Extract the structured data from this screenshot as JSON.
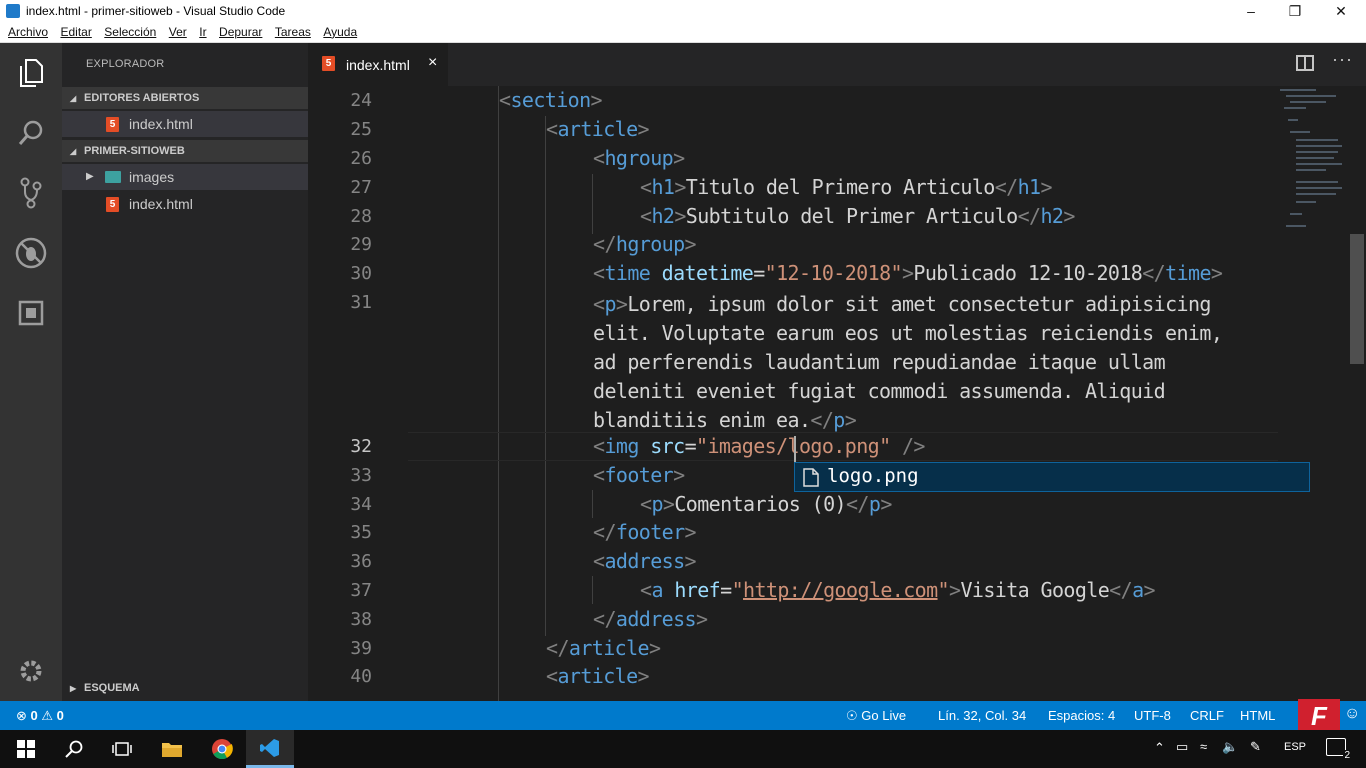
{
  "window": {
    "title": "index.html - primer-sitioweb - Visual Studio Code"
  },
  "menu": [
    "Archivo",
    "Editar",
    "Selección",
    "Ver",
    "Ir",
    "Depurar",
    "Tareas",
    "Ayuda"
  ],
  "sidebar": {
    "header": "EXPLORADOR",
    "open_editors_label": "EDITORES ABIERTOS",
    "open_editors": [
      {
        "name": "index.html"
      }
    ],
    "folder_label": "PRIMER-SITIOWEB",
    "folder_items": [
      {
        "name": "images"
      },
      {
        "name": "index.html"
      }
    ],
    "outline_label": "ESQUEMA"
  },
  "tab": {
    "label": "index.html",
    "close": "×"
  },
  "editor": {
    "current_line": "32",
    "lines": [
      {
        "n": "24",
        "t": "<section>"
      },
      {
        "n": "25",
        "t": "<article>"
      },
      {
        "n": "26",
        "t": "<hgroup>"
      },
      {
        "n": "27",
        "t": "<h1>Titulo del Primero Articulo</h1>"
      },
      {
        "n": "28",
        "t": "<h2>Subtitulo del Primer Articulo</h2>"
      },
      {
        "n": "29",
        "t": "</hgroup>"
      },
      {
        "n": "30",
        "t": "<time datetime=\"12-10-2018\">Publicado 12-10-2018</time>"
      },
      {
        "n": "31",
        "t": "<p>Lorem, ipsum dolor sit amet consectetur adipisicing elit. Voluptate earum eos ut molestias reiciendis enim, ad perferendis laudantium repudiandae itaque ullam deleniti eveniet fugiat commodi assumenda. Aliquid blanditiis enim ea.</p>"
      },
      {
        "n": "32",
        "t": "<img src=\"images/logo.png\" />"
      },
      {
        "n": "33",
        "t": "<footer>"
      },
      {
        "n": "34",
        "t": "<p>Comentarios (0)</p>"
      },
      {
        "n": "35",
        "t": "</footer>"
      },
      {
        "n": "36",
        "t": "<address>"
      },
      {
        "n": "37",
        "t": "<a href=\"http://google.com\">Visita Google</a>"
      },
      {
        "n": "38",
        "t": "</address>"
      },
      {
        "n": "39",
        "t": "</article>"
      },
      {
        "n": "40",
        "t": "<article>"
      }
    ],
    "suggestion": "logo.png"
  },
  "status": {
    "errors": "0",
    "warnings": "0",
    "golive": "Go Live",
    "position": "Lín. 32, Col. 34",
    "spaces": "Espacios: 4",
    "encoding": "UTF-8",
    "eol": "CRLF",
    "language": "HTML"
  },
  "taskbar": {
    "lang": "ESP",
    "notifications": "2"
  },
  "colors": {
    "accent": "#007acc",
    "tag": "#569cd6",
    "attr": "#9cdcfe",
    "string": "#ce9178",
    "html5_icon": "#e44d26"
  }
}
